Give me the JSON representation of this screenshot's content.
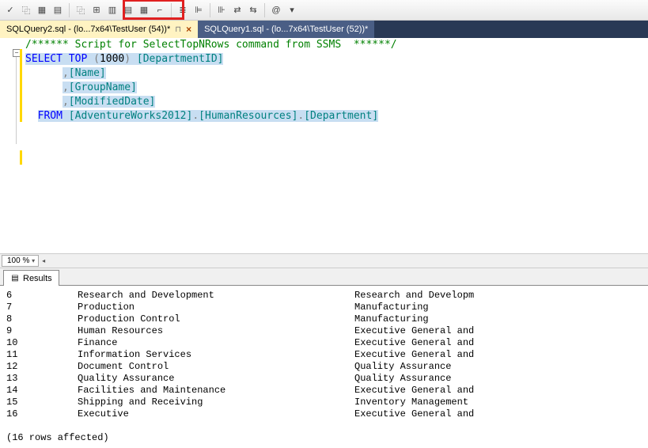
{
  "toolbar": {
    "icons": [
      "✓",
      "⿻",
      "▦",
      "▤",
      "⿻",
      "⊞",
      "▥",
      "▤",
      "▦",
      "⌐",
      "≣",
      "⊫",
      "⊪",
      "⇄",
      "⇆",
      "@",
      "▾"
    ]
  },
  "tabs": {
    "active": {
      "label": "SQLQuery2.sql - (lo...7x64\\TestUser (54))*",
      "pin": "⊓",
      "close": "×"
    },
    "inactive": {
      "label": "SQLQuery1.sql - (lo...7x64\\TestUser (52))*"
    }
  },
  "editor": {
    "comment": "/****** Script for SelectTopNRows command from SSMS  ******/",
    "select_kw": "SELECT",
    "top_kw": "TOP",
    "topn": "1000",
    "col_dept": "[DepartmentID]",
    "col_name": "[Name]",
    "col_group": "[GroupName]",
    "col_mod": "[ModifiedDate]",
    "from_kw": "FROM",
    "db": "[AdventureWorks2012]",
    "sch": "[HumanResources]",
    "tbl": "[Department]",
    "dot": "."
  },
  "zoom": {
    "value": "100 %"
  },
  "results": {
    "tab_label": "Results",
    "rows": [
      {
        "id": "6",
        "name": "Research and Development",
        "group": "Research and Developm"
      },
      {
        "id": "7",
        "name": "Production",
        "group": "Manufacturing"
      },
      {
        "id": "8",
        "name": "Production Control",
        "group": "Manufacturing"
      },
      {
        "id": "9",
        "name": "Human Resources",
        "group": "Executive General and"
      },
      {
        "id": "10",
        "name": "Finance",
        "group": "Executive General and"
      },
      {
        "id": "11",
        "name": "Information Services",
        "group": "Executive General and"
      },
      {
        "id": "12",
        "name": "Document Control",
        "group": "Quality Assurance"
      },
      {
        "id": "13",
        "name": "Quality Assurance",
        "group": "Quality Assurance"
      },
      {
        "id": "14",
        "name": "Facilities and Maintenance",
        "group": "Executive General and"
      },
      {
        "id": "15",
        "name": "Shipping and Receiving",
        "group": "Inventory Management"
      },
      {
        "id": "16",
        "name": "Executive",
        "group": "Executive General and"
      }
    ],
    "affected": "(16 rows affected)"
  }
}
